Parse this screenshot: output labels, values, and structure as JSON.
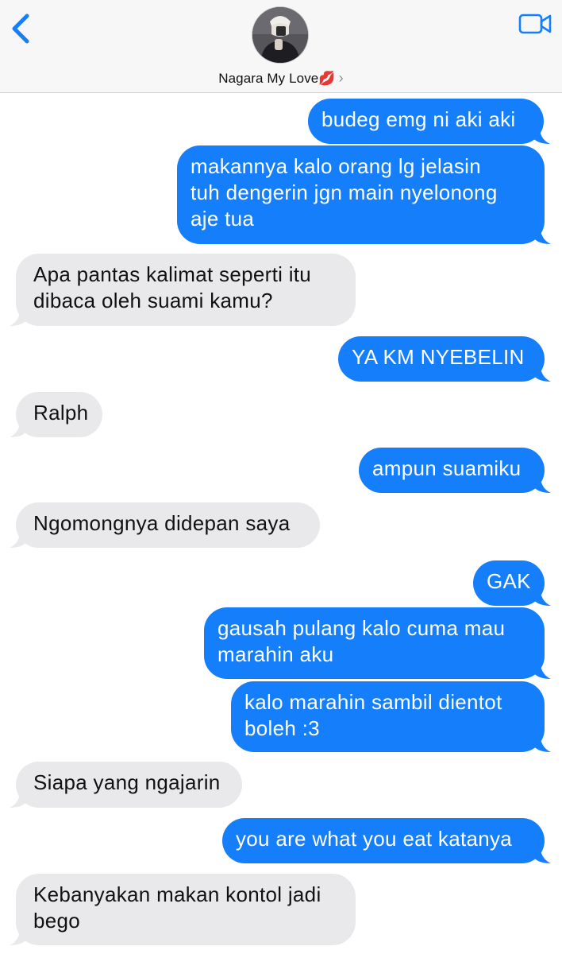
{
  "header": {
    "contact_name": "Nagara My Love",
    "contact_emoji": "💋",
    "chevron": "›",
    "back_icon": "chevron-left-icon",
    "video_icon": "video-camera-icon",
    "accent_color": "#147efb"
  },
  "messages": [
    {
      "side": "out",
      "lines": [
        "budeg emg ni aki aki"
      ]
    },
    {
      "side": "out",
      "lines": [
        "makannya kalo orang lg jelasin",
        "tuh dengerin jgn main nyelonong",
        "aje tua"
      ]
    },
    {
      "side": "in",
      "lines": [
        "Apa pantas kalimat seperti itu",
        "dibaca oleh suami kamu?"
      ]
    },
    {
      "side": "out",
      "lines": [
        "YA KM NYEBELIN"
      ]
    },
    {
      "side": "in",
      "lines": [
        "Ralph"
      ]
    },
    {
      "side": "out",
      "lines": [
        "ampun suamiku"
      ]
    },
    {
      "side": "in",
      "lines": [
        "Ngomongnya didepan saya"
      ]
    },
    {
      "side": "out",
      "lines": [
        "GAK"
      ]
    },
    {
      "side": "out",
      "lines": [
        "gausah pulang kalo cuma mau",
        "marahin aku"
      ]
    },
    {
      "side": "out",
      "lines": [
        "kalo marahin sambil dientot",
        "boleh :3"
      ]
    },
    {
      "side": "in",
      "lines": [
        "Siapa yang ngajarin"
      ]
    },
    {
      "side": "out",
      "lines": [
        "you are what you eat katanya"
      ]
    },
    {
      "side": "in",
      "lines": [
        "Kebanyakan makan kontol jadi",
        "bego"
      ]
    }
  ],
  "colors": {
    "outgoing_bubble": "#147efb",
    "incoming_bubble": "#e9e9eb"
  }
}
